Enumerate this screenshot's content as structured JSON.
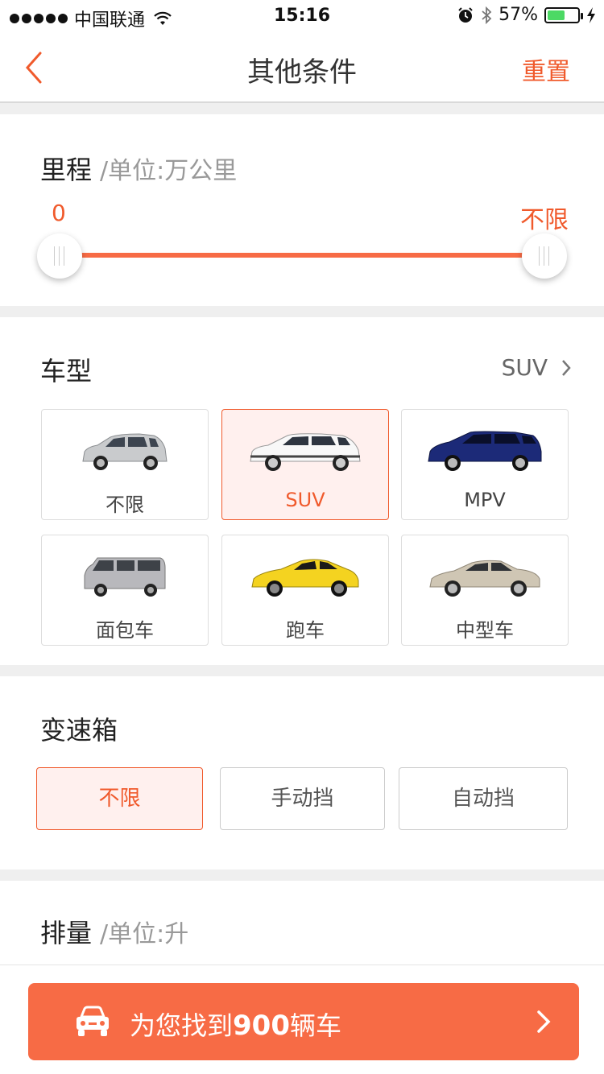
{
  "status_bar": {
    "carrier": "中国联通",
    "time": "15:16",
    "battery_percent": "57%",
    "battery_level": 0.57,
    "icons": [
      "signal-dots-icon",
      "wifi-icon",
      "alarm-icon",
      "bluetooth-icon",
      "battery-icon",
      "charging-icon"
    ]
  },
  "nav": {
    "title": "其他条件",
    "reset": "重置"
  },
  "mileage": {
    "title": "里程",
    "unit": "/单位:万公里",
    "min_label": "0",
    "max_label": "不限"
  },
  "car_type": {
    "title": "车型",
    "current": "SUV",
    "options": [
      {
        "label": "不限",
        "selected": false
      },
      {
        "label": "SUV",
        "selected": true
      },
      {
        "label": "MPV",
        "selected": false
      },
      {
        "label": "面包车",
        "selected": false
      },
      {
        "label": "跑车",
        "selected": false
      },
      {
        "label": "中型车",
        "selected": false
      }
    ]
  },
  "transmission": {
    "title": "变速箱",
    "options": [
      {
        "label": "不限",
        "selected": true
      },
      {
        "label": "手动挡",
        "selected": false
      },
      {
        "label": "自动挡",
        "selected": false
      }
    ]
  },
  "displacement": {
    "title": "排量",
    "unit": "/单位:升"
  },
  "result_button": {
    "prefix": "为您找到",
    "count": "900",
    "suffix": "辆车"
  },
  "colors": {
    "accent": "#f05a2c",
    "button": "#f76b45",
    "selected_bg": "#fff0ee"
  }
}
